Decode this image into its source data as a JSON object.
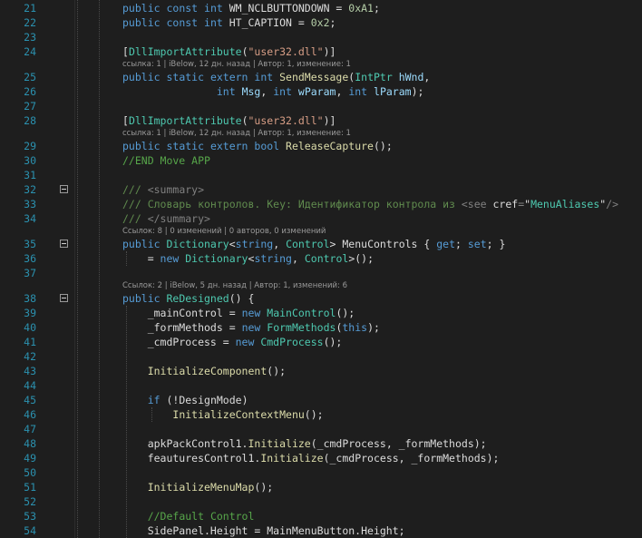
{
  "theme": {
    "background": "#1e1e1e",
    "line_number": "#2b91af",
    "keyword": "#569cd6",
    "type": "#4ec9b0",
    "string": "#d69d85",
    "comment": "#57a64a",
    "codelens": "#9a9a9a"
  },
  "rows": [
    {
      "kind": "code",
      "ln": "21",
      "tokens": [
        [
          "kw",
          "public "
        ],
        [
          "kw",
          "const "
        ],
        [
          "kw",
          "int "
        ],
        [
          "id",
          "WM_NCLBUTTONDOWN = "
        ],
        [
          "num",
          "0xA1"
        ],
        [
          "id",
          ";"
        ]
      ]
    },
    {
      "kind": "code",
      "ln": "22",
      "tokens": [
        [
          "kw",
          "public "
        ],
        [
          "kw",
          "const "
        ],
        [
          "kw",
          "int "
        ],
        [
          "id",
          "HT_CAPTION = "
        ],
        [
          "num",
          "0x2"
        ],
        [
          "id",
          ";"
        ]
      ]
    },
    {
      "kind": "code",
      "ln": "23",
      "tokens": []
    },
    {
      "kind": "code",
      "ln": "24",
      "tokens": [
        [
          "id",
          "["
        ],
        [
          "type",
          "DllImportAttribute"
        ],
        [
          "id",
          "("
        ],
        [
          "str",
          "\"user32.dll\""
        ],
        [
          "id",
          ")]"
        ]
      ]
    },
    {
      "kind": "lens",
      "text": "ссылка: 1 | iBelow, 12 дн. назад | Автор: 1, изменение: 1"
    },
    {
      "kind": "code",
      "ln": "25",
      "tokens": [
        [
          "kw",
          "public "
        ],
        [
          "kw",
          "static "
        ],
        [
          "kw",
          "extern "
        ],
        [
          "kw",
          "int "
        ],
        [
          "method",
          "SendMessage"
        ],
        [
          "id",
          "("
        ],
        [
          "type",
          "IntPtr "
        ],
        [
          "param",
          "hWnd"
        ],
        [
          "id",
          ","
        ]
      ]
    },
    {
      "kind": "code",
      "ln": "26",
      "tokens": [
        [
          "id",
          "               "
        ],
        [
          "kw",
          "int "
        ],
        [
          "param",
          "Msg"
        ],
        [
          "id",
          ", "
        ],
        [
          "kw",
          "int "
        ],
        [
          "param",
          "wParam"
        ],
        [
          "id",
          ", "
        ],
        [
          "kw",
          "int "
        ],
        [
          "param",
          "lParam"
        ],
        [
          "id",
          ");"
        ]
      ]
    },
    {
      "kind": "code",
      "ln": "27",
      "tokens": []
    },
    {
      "kind": "code",
      "ln": "28",
      "tokens": [
        [
          "id",
          "["
        ],
        [
          "type",
          "DllImportAttribute"
        ],
        [
          "id",
          "("
        ],
        [
          "str",
          "\"user32.dll\""
        ],
        [
          "id",
          ")]"
        ]
      ]
    },
    {
      "kind": "lens",
      "text": "ссылка: 1 | iBelow, 12 дн. назад | Автор: 1, изменение: 1"
    },
    {
      "kind": "code",
      "ln": "29",
      "tokens": [
        [
          "kw",
          "public "
        ],
        [
          "kw",
          "static "
        ],
        [
          "kw",
          "extern "
        ],
        [
          "kw",
          "bool "
        ],
        [
          "method",
          "ReleaseCapture"
        ],
        [
          "id",
          "();"
        ]
      ]
    },
    {
      "kind": "code",
      "ln": "30",
      "tokens": [
        [
          "cm",
          "//END Move APP"
        ]
      ]
    },
    {
      "kind": "code",
      "ln": "31",
      "tokens": []
    },
    {
      "kind": "code",
      "ln": "32",
      "fold": true,
      "tokens": [
        [
          "doc",
          "/// "
        ],
        [
          "tag",
          "<summary>"
        ]
      ]
    },
    {
      "kind": "code",
      "ln": "33",
      "tokens": [
        [
          "doc",
          "/// Словарь контролов. Key: Идентификатор контрола из "
        ],
        [
          "tag",
          "<see "
        ],
        [
          "id",
          "cref"
        ],
        [
          "tag",
          "="
        ],
        [
          "id",
          "\""
        ],
        [
          "type",
          "MenuAliases"
        ],
        [
          "id",
          "\""
        ],
        [
          "tag",
          "/>"
        ]
      ]
    },
    {
      "kind": "code",
      "ln": "34",
      "tokens": [
        [
          "doc",
          "/// "
        ],
        [
          "tag",
          "</summary>"
        ]
      ]
    },
    {
      "kind": "lens",
      "text": "Ссылок: 8 | 0 изменений | 0 авторов, 0 изменений"
    },
    {
      "kind": "code",
      "ln": "35",
      "fold": true,
      "tokens": [
        [
          "kw",
          "public "
        ],
        [
          "type",
          "Dictionary"
        ],
        [
          "id",
          "<"
        ],
        [
          "kw",
          "string"
        ],
        [
          "id",
          ", "
        ],
        [
          "type",
          "Control"
        ],
        [
          "id",
          "> MenuControls { "
        ],
        [
          "kw",
          "get"
        ],
        [
          "id",
          "; "
        ],
        [
          "kw",
          "set"
        ],
        [
          "id",
          "; }"
        ]
      ]
    },
    {
      "kind": "code",
      "ln": "36",
      "tokens": [
        [
          "id",
          "    = "
        ],
        [
          "kw",
          "new "
        ],
        [
          "type",
          "Dictionary"
        ],
        [
          "id",
          "<"
        ],
        [
          "kw",
          "string"
        ],
        [
          "id",
          ", "
        ],
        [
          "type",
          "Control"
        ],
        [
          "id",
          ">();"
        ]
      ]
    },
    {
      "kind": "code",
      "ln": "37",
      "tokens": []
    },
    {
      "kind": "lens",
      "text": "Ссылок: 2 | iBelow, 5 дн. назад | Автор: 1, изменений: 6"
    },
    {
      "kind": "code",
      "ln": "38",
      "fold": true,
      "tokens": [
        [
          "kw",
          "public "
        ],
        [
          "type",
          "ReDesigned"
        ],
        [
          "id",
          "() {"
        ]
      ]
    },
    {
      "kind": "code",
      "ln": "39",
      "tokens": [
        [
          "id",
          "    _mainControl = "
        ],
        [
          "kw",
          "new "
        ],
        [
          "type",
          "MainControl"
        ],
        [
          "id",
          "();"
        ]
      ]
    },
    {
      "kind": "code",
      "ln": "40",
      "tokens": [
        [
          "id",
          "    _formMethods = "
        ],
        [
          "kw",
          "new "
        ],
        [
          "type",
          "FormMethods"
        ],
        [
          "id",
          "("
        ],
        [
          "kw",
          "this"
        ],
        [
          "id",
          ");"
        ]
      ]
    },
    {
      "kind": "code",
      "ln": "41",
      "tokens": [
        [
          "id",
          "    _cmdProcess = "
        ],
        [
          "kw",
          "new "
        ],
        [
          "type",
          "CmdProcess"
        ],
        [
          "id",
          "();"
        ]
      ]
    },
    {
      "kind": "code",
      "ln": "42",
      "tokens": []
    },
    {
      "kind": "code",
      "ln": "43",
      "tokens": [
        [
          "id",
          "    "
        ],
        [
          "method",
          "InitializeComponent"
        ],
        [
          "id",
          "();"
        ]
      ]
    },
    {
      "kind": "code",
      "ln": "44",
      "tokens": []
    },
    {
      "kind": "code",
      "ln": "45",
      "tokens": [
        [
          "id",
          "    "
        ],
        [
          "kw",
          "if "
        ],
        [
          "id",
          "(!DesignMode)"
        ]
      ]
    },
    {
      "kind": "code",
      "ln": "46",
      "tokens": [
        [
          "id",
          "        "
        ],
        [
          "method",
          "InitializeContextMenu"
        ],
        [
          "id",
          "();"
        ]
      ]
    },
    {
      "kind": "code",
      "ln": "47",
      "tokens": []
    },
    {
      "kind": "code",
      "ln": "48",
      "tokens": [
        [
          "id",
          "    apkPackControl1."
        ],
        [
          "method",
          "Initialize"
        ],
        [
          "id",
          "(_cmdProcess, _formMethods);"
        ]
      ]
    },
    {
      "kind": "code",
      "ln": "49",
      "tokens": [
        [
          "id",
          "    feauturesControl1."
        ],
        [
          "method",
          "Initialize"
        ],
        [
          "id",
          "(_cmdProcess, _formMethods);"
        ]
      ]
    },
    {
      "kind": "code",
      "ln": "50",
      "tokens": []
    },
    {
      "kind": "code",
      "ln": "51",
      "tokens": [
        [
          "id",
          "    "
        ],
        [
          "method",
          "InitializeMenuMap"
        ],
        [
          "id",
          "();"
        ]
      ]
    },
    {
      "kind": "code",
      "ln": "52",
      "tokens": []
    },
    {
      "kind": "code",
      "ln": "53",
      "tokens": [
        [
          "id",
          "    "
        ],
        [
          "cm",
          "//Default Control"
        ]
      ]
    },
    {
      "kind": "code",
      "ln": "54",
      "tokens": [
        [
          "id",
          "    SidePanel.Height = MainMenuButton.Height;"
        ]
      ]
    }
  ]
}
